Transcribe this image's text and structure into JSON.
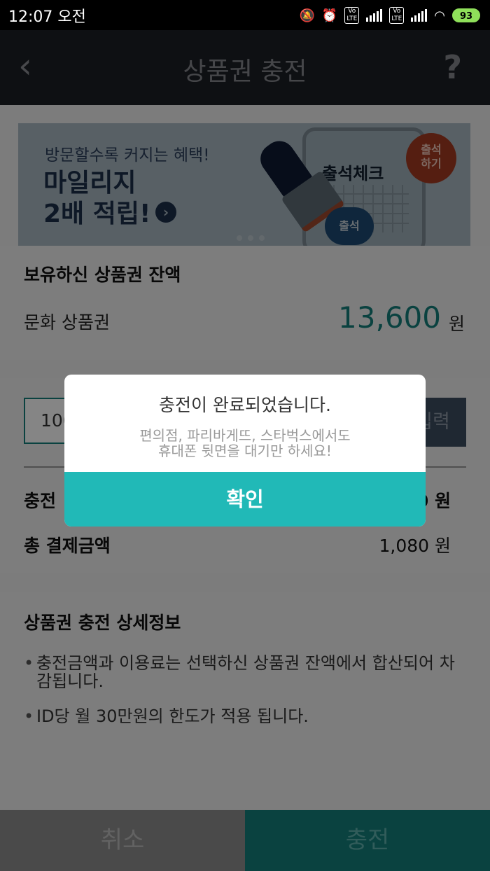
{
  "status_bar": {
    "time": "12:07 오전",
    "battery": "93"
  },
  "header": {
    "back_icon": "‹",
    "title": "상품권 충전",
    "help_icon": "?"
  },
  "banner": {
    "subtitle": "방문할수록 커지는 혜택!",
    "headline": "마일리지\n2배 적립!",
    "arrow_icon": "›",
    "calendar_title": "출석체크",
    "stamp_text": "출석",
    "badge_text": "출석\n하기"
  },
  "balance": {
    "heading": "보유하신 상품권 잔액",
    "label": "문화 상품권",
    "amount": "13,600",
    "unit": "원"
  },
  "charge_form": {
    "amount_value": "100",
    "input_button": "입력",
    "row1_label": "충전",
    "row1_value": "0 원",
    "total_label": "총 결제금액",
    "total_value": "1,080 원"
  },
  "details": {
    "heading": "상품권 충전 상세정보",
    "bullets": [
      "충전금액과 이용료는 선택하신 상품권 잔액에서 합산되어 차감됩니다.",
      "ID당 월 30만원의 한도가 적용 됩니다."
    ]
  },
  "bottom": {
    "cancel": "취소",
    "charge": "충전"
  },
  "dialog": {
    "title": "충전이 완료되었습니다.",
    "message_line1": "편의점, 파리바게뜨, 스타벅스에서도",
    "message_line2": "휴대폰 뒷면을 대기만 하세요!",
    "ok": "확인"
  },
  "colors": {
    "accent": "#21b9b7",
    "accent_dark": "#157f7c",
    "header_bg": "#1c1f26"
  }
}
